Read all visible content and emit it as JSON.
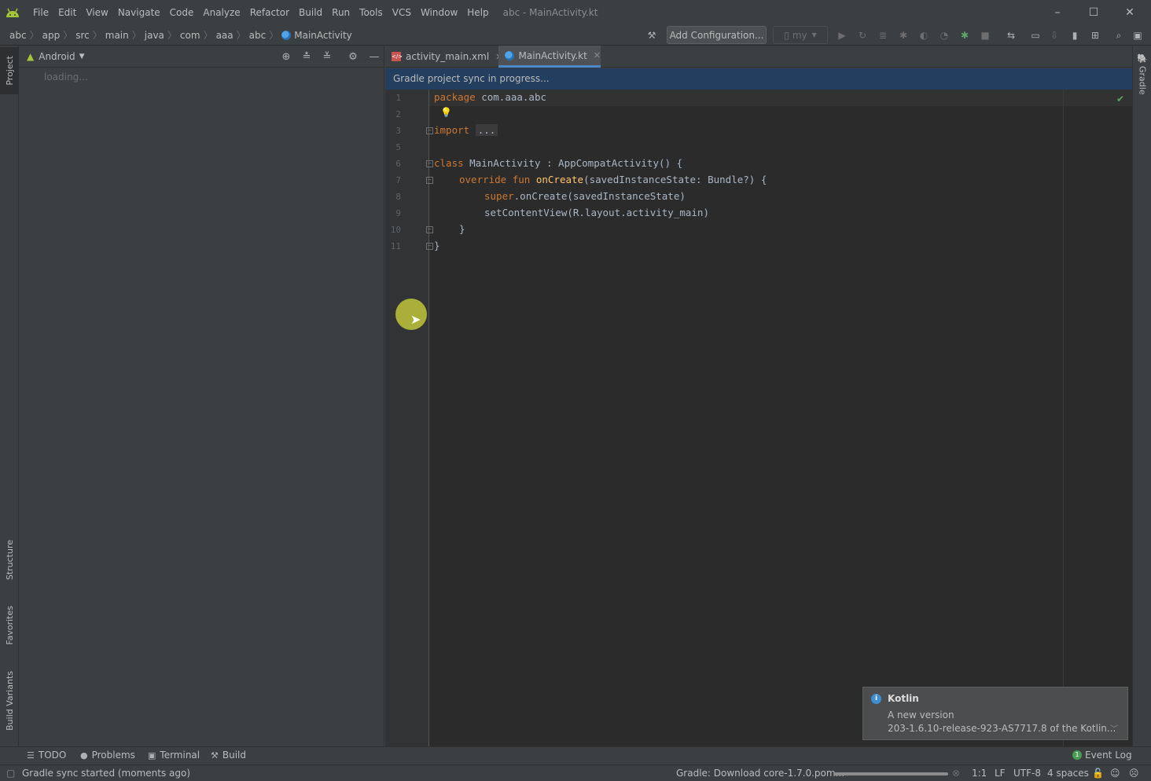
{
  "menu": {
    "items": [
      "File",
      "Edit",
      "View",
      "Navigate",
      "Code",
      "Analyze",
      "Refactor",
      "Build",
      "Run",
      "Tools",
      "VCS",
      "Window",
      "Help"
    ],
    "window_title": "abc - MainActivity.kt"
  },
  "window_controls": {
    "minimize": "–",
    "maximize": "☐",
    "close": "✕"
  },
  "breadcrumb": {
    "items": [
      "abc",
      "app",
      "src",
      "main",
      "java",
      "com",
      "aaa",
      "abc",
      "MainActivity"
    ]
  },
  "toolbar": {
    "add_configuration": "Add Configuration...",
    "device": "my"
  },
  "left_stripe": {
    "project": "Project",
    "structure": "Structure",
    "favorites": "Favorites",
    "build_variants": "Build Variants"
  },
  "project_panel": {
    "view": "Android",
    "loading": "loading..."
  },
  "editor_tabs": [
    {
      "label": "activity_main.xml"
    },
    {
      "label": "MainActivity.kt"
    }
  ],
  "sync_banner": "Gradle project sync in progress...",
  "editor": {
    "line_numbers": [
      "1",
      "2",
      "3",
      "5",
      "6",
      "7",
      "8",
      "9",
      "10",
      "11"
    ],
    "code": {
      "l1_kw": "package",
      "l1_rest": " com.aaa.abc",
      "l3_kw": "import",
      "l3_fold": "...",
      "l6_kw": "class",
      "l6_rest": " MainActivity : AppCompatActivity() {",
      "l7_kw": "override fun ",
      "l7_fn": "onCreate",
      "l7_rest": "(savedInstanceState: Bundle?) {",
      "l8_kw": "super",
      "l8_rest": ".onCreate(savedInstanceState)",
      "l9": "setContentView(R.layout.activity_main)",
      "l10": "}",
      "l11": "}"
    }
  },
  "right_stripe": {
    "gradle": "Gradle"
  },
  "notification": {
    "title": "Kotlin",
    "line1": "A new version",
    "line2": "203-1.6.10-release-923-AS7717.8 of the Kotlin..."
  },
  "bottom_tools": {
    "todo": "TODO",
    "problems": "Problems",
    "terminal": "Terminal",
    "build": "Build",
    "event_log": "Event Log",
    "event_log_count": "1"
  },
  "status": {
    "message": "Gradle sync started (moments ago)",
    "download": "Gradle: Download core-1.7.0.pom...",
    "download_progress": 1.0,
    "position": "1:1",
    "line_sep": "LF",
    "encoding": "UTF-8",
    "indent": "4 spaces"
  },
  "colors": {
    "accent": "#4a88c7",
    "banner": "#233e5f",
    "keyword": "#cc7832",
    "function": "#ffc66d",
    "android_green": "#a4c639"
  }
}
